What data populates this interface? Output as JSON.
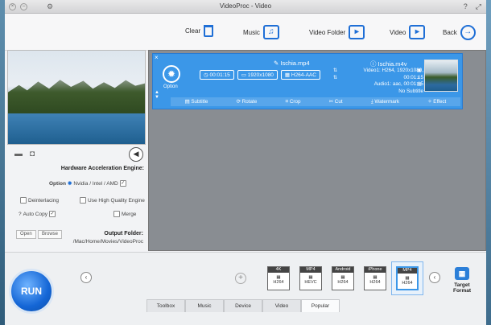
{
  "window": {
    "title": "VideoProc - Video",
    "btn_close": "×",
    "btn_min": "–",
    "btn_gear": "⚙",
    "btn_help": "?",
    "btn_max": "⤢"
  },
  "toolbar": {
    "back": "Back",
    "video": "Video",
    "video_folder": "Video Folder",
    "music": "Music",
    "clear": "Clear"
  },
  "item": {
    "close": "×",
    "output_name": "Ischia.mp4",
    "option": "Option",
    "resolution": "1920x1080",
    "duration": "00:01:15",
    "codec": "H264-AAC",
    "source_name": "Ischia.m4v",
    "source_video": "Video1: H264, 1920x1080, 00:01:15",
    "source_audio": "Audio1: aac, 00:01:15",
    "source_subtitle": "No Subtitle",
    "tools": [
      "Effect",
      "Watermark",
      "Cut",
      "Crop",
      "Rotate",
      "Subtitle"
    ]
  },
  "hardware": {
    "title": "Hardware Acceleration Engine:",
    "option": "Option",
    "vendor": "Nvidia / Intel / AMD",
    "high_quality": "Use High Quality Engine",
    "deinterlacing": "Deinterlacing",
    "merge": "Merge",
    "auto_copy": "Auto Copy"
  },
  "output": {
    "title": "Output Folder:",
    "path": "/Mac/Home/Movies/VideoProc",
    "browse": "Browse",
    "open": "Open"
  },
  "run_label": "RUN",
  "target_format": "Target Format",
  "presets": [
    {
      "top": "MP4",
      "bottom": "H264"
    },
    {
      "top": "iPhone",
      "bottom": "H264"
    },
    {
      "top": "Android",
      "bottom": "H264"
    },
    {
      "top": "MP4",
      "bottom": "HEVC"
    },
    {
      "top": "4K",
      "bottom": "H264"
    }
  ],
  "tabs": [
    "Popular",
    "Video",
    "Device",
    "Music",
    "Toolbox"
  ],
  "colors": {
    "accent": "#3b97e8",
    "list_bg": "#898d92",
    "run_blue": "#1466d6"
  }
}
